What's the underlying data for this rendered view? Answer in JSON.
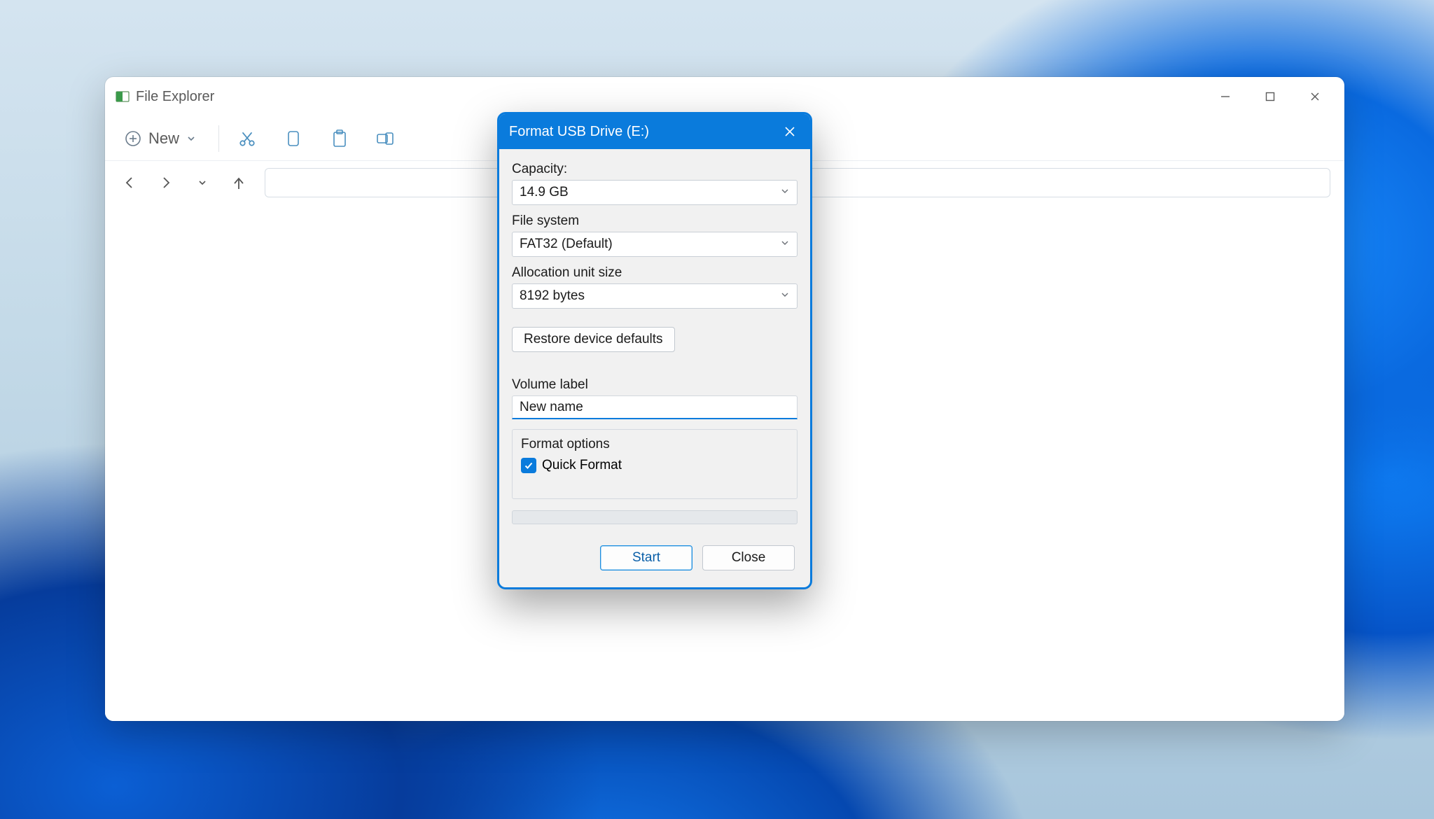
{
  "explorer": {
    "title": "File Explorer",
    "toolbar": {
      "new_label": "New"
    }
  },
  "dialog": {
    "title": "Format USB Drive (E:)",
    "capacity_label": "Capacity:",
    "capacity_value": "14.9 GB",
    "filesystem_label": "File system",
    "filesystem_value": "FAT32 (Default)",
    "allocation_label": "Allocation unit size",
    "allocation_value": "8192 bytes",
    "restore_label": "Restore device defaults",
    "volume_label_label": "Volume label",
    "volume_label_value": "New name",
    "options_label": "Format options",
    "quick_format_label": "Quick Format",
    "quick_format_checked": true,
    "start_label": "Start",
    "close_label": "Close"
  }
}
